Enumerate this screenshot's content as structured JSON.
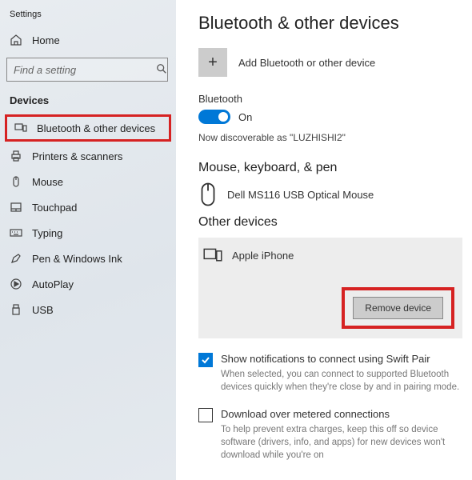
{
  "window_title": "Settings",
  "sidebar": {
    "home": "Home",
    "search_placeholder": "Find a setting",
    "section": "Devices",
    "items": [
      "Bluetooth & other devices",
      "Printers & scanners",
      "Mouse",
      "Touchpad",
      "Typing",
      "Pen & Windows Ink",
      "AutoPlay",
      "USB"
    ]
  },
  "main": {
    "title": "Bluetooth & other devices",
    "add_label": "Add Bluetooth or other device",
    "bt_label": "Bluetooth",
    "toggle_state": "On",
    "discoverable": "Now discoverable as \"LUZHISHI2\"",
    "mouse_section": "Mouse, keyboard, & pen",
    "mouse_device": "Dell MS116 USB Optical Mouse",
    "other_section": "Other devices",
    "other_device": "Apple iPhone",
    "remove_btn": "Remove device",
    "swift_label": "Show notifications to connect using Swift Pair",
    "swift_help": "When selected, you can connect to supported Bluetooth devices quickly when they're close by and in pairing mode.",
    "metered_label": "Download over metered connections",
    "metered_help": "To help prevent extra charges, keep this off so device software (drivers, info, and apps) for new devices won't download while you're on"
  }
}
